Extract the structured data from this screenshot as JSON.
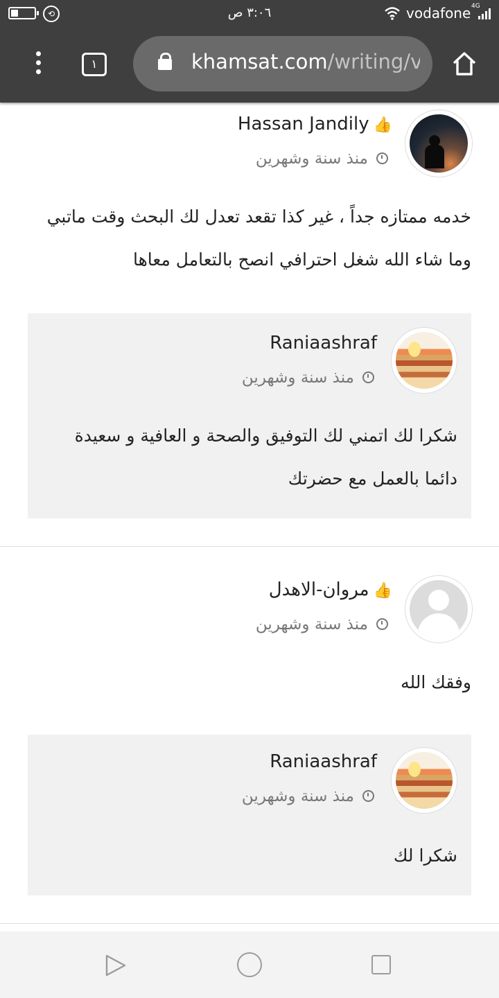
{
  "status_bar": {
    "time": "٣:٠٦ ص",
    "carrier": "vodafone",
    "network": "4G",
    "battery_level": 0.3
  },
  "browser": {
    "tab_count": "١",
    "url_domain": "khamsat.com",
    "url_path": "/writing/v",
    "icons": [
      "menu-dots-icon",
      "lock-icon",
      "home-icon"
    ]
  },
  "comments": [
    {
      "author": "Hassan Jandily",
      "time": "منذ سنة وشهرين",
      "text": "خدمه ممتازه جداً ، غير كذا تقعد تعدل لك البحث وقت ماتبي وما شاء الله شغل احترافي انصح بالتعامل معاها",
      "reply": {
        "author": "Raniaashraf",
        "time": "منذ سنة وشهرين",
        "text": "شكرا لك اتمني لك التوفيق والصحة و العافية و سعيدة دائما بالعمل مع حضرتك"
      }
    },
    {
      "author": "مروان-الاهدل",
      "time": "منذ سنة وشهرين",
      "text": "وفقك الله",
      "reply": {
        "author": "Raniaashraf",
        "time": "منذ سنة وشهرين",
        "text": "شكرا لك"
      }
    }
  ],
  "colors": {
    "toolbar": "#3f3f3f",
    "url_pill": "#6a6a6a",
    "reply_bg": "#f1f1f1",
    "muted_text": "#777777"
  }
}
